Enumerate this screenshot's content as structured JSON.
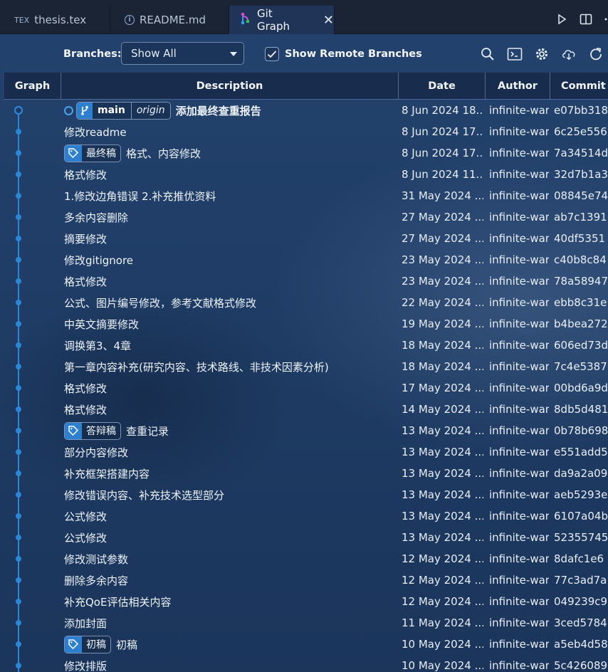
{
  "tabs": [
    {
      "label": "thesis.tex",
      "icon": "tex-icon",
      "active": false
    },
    {
      "label": "README.md",
      "icon": "info-icon",
      "active": false
    },
    {
      "label": "Git Graph",
      "icon": "git-graph-icon",
      "active": true
    }
  ],
  "tex_glyph": "TEX",
  "controls": {
    "branches_label": "Branches:",
    "branches_value": "Show All",
    "show_remote_label": "Show Remote Branches",
    "show_remote_checked": true
  },
  "columns": {
    "graph": "Graph",
    "description": "Description",
    "date": "Date",
    "author": "Author",
    "commit": "Commit"
  },
  "colors": {
    "graph_line": "#2b86d6",
    "accent": "#2d7fd0"
  },
  "commits": [
    {
      "description": "添加最终查重报告",
      "date": "8 Jun 2024 18...",
      "author": "infinite-war",
      "commit": "e07bb318",
      "head": true,
      "branch": "main",
      "remote": "origin"
    },
    {
      "description": "修改readme",
      "date": "8 Jun 2024 17...",
      "author": "infinite-war",
      "commit": "6c25e556"
    },
    {
      "description": "格式、内容修改",
      "date": "8 Jun 2024 17...",
      "author": "infinite-war",
      "commit": "7a34514d",
      "tag": "最终稿"
    },
    {
      "description": "格式修改",
      "date": "8 Jun 2024 11...",
      "author": "infinite-war",
      "commit": "32d7b1a3"
    },
    {
      "description": "1.修改边角错误 2.补充推优资料",
      "date": "31 May 2024 ...",
      "author": "infinite-war",
      "commit": "08845e74"
    },
    {
      "description": "多余内容删除",
      "date": "27 May 2024 ...",
      "author": "infinite-war",
      "commit": "ab7c1391"
    },
    {
      "description": "摘要修改",
      "date": "27 May 2024 ...",
      "author": "infinite-war",
      "commit": "40df5351"
    },
    {
      "description": "修改gitignore",
      "date": "23 May 2024 ...",
      "author": "infinite-war",
      "commit": "c40b8c84"
    },
    {
      "description": "格式修改",
      "date": "23 May 2024 ...",
      "author": "infinite-war",
      "commit": "78a58947"
    },
    {
      "description": "公式、图片编号修改，参考文献格式修改",
      "date": "22 May 2024 ...",
      "author": "infinite-war",
      "commit": "ebb8c31e"
    },
    {
      "description": "中英文摘要修改",
      "date": "19 May 2024 ...",
      "author": "infinite-war",
      "commit": "b4bea272"
    },
    {
      "description": "调换第3、4章",
      "date": "18 May 2024 ...",
      "author": "infinite-war",
      "commit": "606ed73d"
    },
    {
      "description": "第一章内容补充(研究内容、技术路线、非技术因素分析)",
      "date": "18 May 2024 ...",
      "author": "infinite-war",
      "commit": "7c4e5387"
    },
    {
      "description": "格式修改",
      "date": "17 May 2024 ...",
      "author": "infinite-war",
      "commit": "00bd6a9d"
    },
    {
      "description": "格式修改",
      "date": "14 May 2024 ...",
      "author": "infinite-war",
      "commit": "8db5d481"
    },
    {
      "description": "查重记录",
      "date": "13 May 2024 ...",
      "author": "infinite-war",
      "commit": "0b78b698",
      "tag": "答辩稿"
    },
    {
      "description": "部分内容修改",
      "date": "13 May 2024 ...",
      "author": "infinite-war",
      "commit": "e551add5"
    },
    {
      "description": "补充框架搭建内容",
      "date": "13 May 2024 ...",
      "author": "infinite-war",
      "commit": "da9a2a09"
    },
    {
      "description": "修改错误内容、补充技术选型部分",
      "date": "13 May 2024 ...",
      "author": "infinite-war",
      "commit": "aeb5293e"
    },
    {
      "description": "公式修改",
      "date": "13 May 2024 ...",
      "author": "infinite-war",
      "commit": "6107a04b"
    },
    {
      "description": "公式修改",
      "date": "13 May 2024 ...",
      "author": "infinite-war",
      "commit": "52355745"
    },
    {
      "description": "修改测试参数",
      "date": "12 May 2024 ...",
      "author": "infinite-war",
      "commit": "8dafc1e6"
    },
    {
      "description": "删除多余内容",
      "date": "12 May 2024 ...",
      "author": "infinite-war",
      "commit": "77c3ad7a"
    },
    {
      "description": "补充QoE评估相关内容",
      "date": "12 May 2024 ...",
      "author": "infinite-war",
      "commit": "049239c9"
    },
    {
      "description": "添加封面",
      "date": "11 May 2024 ...",
      "author": "infinite-war",
      "commit": "3ced5784"
    },
    {
      "description": "初稿",
      "date": "10 May 2024 ...",
      "author": "infinite-war",
      "commit": "a5eb4d58",
      "tag": "初稿"
    },
    {
      "description": "修改排版",
      "date": "10 May 2024 ...",
      "author": "infinite-war",
      "commit": "5c426089"
    }
  ]
}
